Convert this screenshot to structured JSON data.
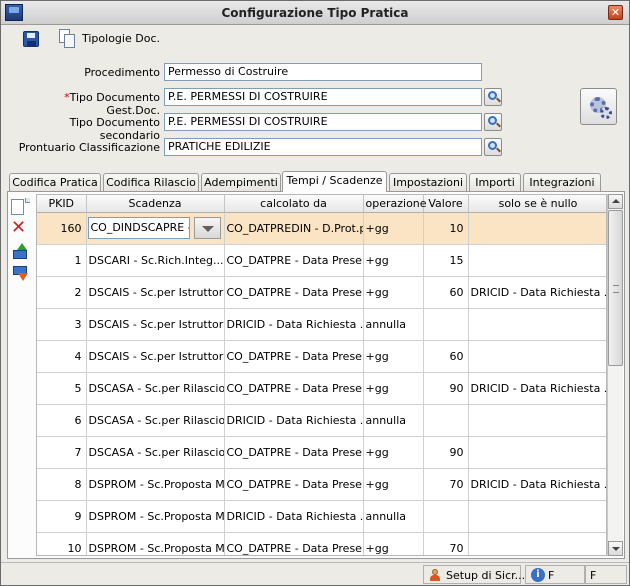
{
  "window": {
    "title": "Configurazione Tipo Pratica",
    "close_glyph": "✕"
  },
  "toolbar": {
    "tipologie_label": "Tipologie Doc."
  },
  "form": {
    "procedimento": {
      "label": "Procedimento",
      "value": "Permesso di Costruire"
    },
    "tipo_documento": {
      "required_mark": "*",
      "label": "Tipo Documento Gest.Doc.",
      "value": "P.E. PERMESSI DI COSTRUIRE"
    },
    "tipo_secondario": {
      "label": "Tipo Documento secondario",
      "value": "P.E. PERMESSI DI COSTRUIRE"
    },
    "prontuario": {
      "label": "Prontuario Classificazione",
      "value": "PRATICHE EDILIZIE"
    }
  },
  "tabs": [
    {
      "label": "Codifica Pratica"
    },
    {
      "label": "Codifica Rilascio"
    },
    {
      "label": "Adempimenti"
    },
    {
      "label": "Tempi / Scadenze"
    },
    {
      "label": "Impostazioni"
    },
    {
      "label": "Importi"
    },
    {
      "label": "Integrazioni"
    }
  ],
  "active_tab": "Tempi / Scadenze",
  "grid": {
    "columns": [
      "PKID",
      "Scadenza",
      "calcolato da",
      "operazione",
      "Valore",
      "solo se è nullo"
    ],
    "rows": [
      {
        "pkid": "160",
        "scadenza": "CO_DINDSCAPRE -...",
        "calcolato_da": "CO_DATPREDIN - D.Prot.pr...",
        "operazione": "+gg",
        "valore": "10",
        "solo_se_nullo": ""
      },
      {
        "pkid": "1",
        "scadenza": "DSCARI - Sc.Rich.Integ....",
        "calcolato_da": "CO_DATPRE - Data Prese...",
        "operazione": "+gg",
        "valore": "15",
        "solo_se_nullo": ""
      },
      {
        "pkid": "2",
        "scadenza": "DSCAIS - Sc.per Istruttoria",
        "calcolato_da": "CO_DATPRE - Data Prese...",
        "operazione": "+gg",
        "valore": "60",
        "solo_se_nullo": "DRICID - Data Richiesta ..."
      },
      {
        "pkid": "3",
        "scadenza": "DSCAIS - Sc.per Istruttoria",
        "calcolato_da": "DRICID - Data Richiesta ...",
        "operazione": "annulla",
        "valore": "",
        "solo_se_nullo": ""
      },
      {
        "pkid": "4",
        "scadenza": "DSCAIS - Sc.per Istruttoria",
        "calcolato_da": "CO_DATPRE - Data Prese...",
        "operazione": "+gg",
        "valore": "60",
        "solo_se_nullo": ""
      },
      {
        "pkid": "5",
        "scadenza": "DSCASA - Sc.per Rilascio",
        "calcolato_da": "CO_DATPRE - Data Prese...",
        "operazione": "+gg",
        "valore": "90",
        "solo_se_nullo": "DRICID - Data Richiesta ..."
      },
      {
        "pkid": "6",
        "scadenza": "DSCASA - Sc.per Rilascio",
        "calcolato_da": "DRICID - Data Richiesta ...",
        "operazione": "annulla",
        "valore": "",
        "solo_se_nullo": ""
      },
      {
        "pkid": "7",
        "scadenza": "DSCASA - Sc.per Rilascio",
        "calcolato_da": "CO_DATPRE - Data Prese...",
        "operazione": "+gg",
        "valore": "90",
        "solo_se_nullo": ""
      },
      {
        "pkid": "8",
        "scadenza": "DSPROM - Sc.Proposta M...",
        "calcolato_da": "CO_DATPRE - Data Prese...",
        "operazione": "+gg",
        "valore": "70",
        "solo_se_nullo": "DRICID - Data Richiesta ..."
      },
      {
        "pkid": "9",
        "scadenza": "DSPROM - Sc.Proposta M...",
        "calcolato_da": "DRICID - Data Richiesta ...",
        "operazione": "annulla",
        "valore": "",
        "solo_se_nullo": ""
      },
      {
        "pkid": "10",
        "scadenza": "DSPROM - Sc.Proposta M...",
        "calcolato_da": "CO_DATPRE - Data Prese...",
        "operazione": "+gg",
        "valore": "70",
        "solo_se_nullo": ""
      }
    ]
  },
  "statusbar": {
    "setup_label": "Setup di Sicr...",
    "user_f": "F",
    "extra_f": "F"
  },
  "colors": {
    "selected_row": "#fbe4c4",
    "required_mark": "#cc0000"
  }
}
